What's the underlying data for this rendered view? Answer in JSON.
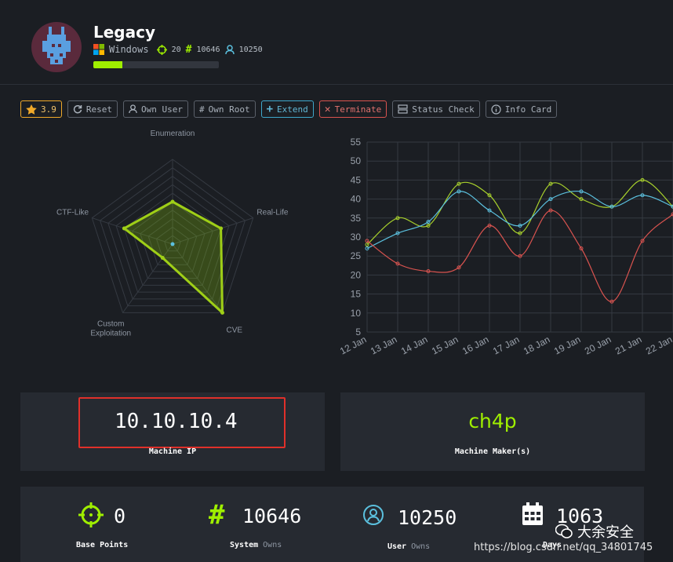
{
  "machine": {
    "name": "Legacy",
    "os": "Windows",
    "points": "20",
    "system_owns": "10646",
    "user_owns": "10250",
    "progress": 0.23
  },
  "toolbar": {
    "rating": "3.9",
    "reset": "Reset",
    "own_user": "Own User",
    "own_root": "Own Root",
    "extend": "Extend",
    "terminate": "Terminate",
    "status_check": "Status Check",
    "info_card": "Info Card"
  },
  "colors": {
    "accent": "#9fef00",
    "blue": "#5bc0de",
    "red": "#d9534f",
    "card": "#262a31"
  },
  "chart_data": [
    {
      "type": "radar",
      "axes": [
        "Enumeration",
        "Real-Life",
        "CVE",
        "Custom Exploitation",
        "CTF-Like"
      ],
      "values": [
        5,
        6,
        10,
        2,
        6
      ],
      "max": 10
    },
    {
      "type": "line",
      "x": [
        "12 Jan",
        "13 Jan",
        "14 Jan",
        "15 Jan",
        "16 Jan",
        "17 Jan",
        "18 Jan",
        "19 Jan",
        "20 Jan",
        "21 Jan",
        "22 Jan"
      ],
      "series": [
        {
          "color": "#a8d02c",
          "values": [
            28,
            35,
            33,
            44,
            41,
            31,
            44,
            40,
            38,
            45,
            38
          ]
        },
        {
          "color": "#5bc0de",
          "values": [
            27,
            31,
            34,
            42,
            37,
            33,
            40,
            42,
            38,
            41,
            38
          ]
        },
        {
          "color": "#d9534f",
          "values": [
            29,
            23,
            21,
            22,
            33,
            25,
            37,
            27,
            13,
            29,
            36
          ]
        }
      ],
      "ylim": [
        5,
        55
      ],
      "yticks": [
        5,
        10,
        15,
        20,
        25,
        30,
        35,
        40,
        45,
        50,
        55
      ],
      "grid": true
    }
  ],
  "ip": {
    "value": "10.10.10.4",
    "label": "Machine IP"
  },
  "maker": {
    "value": "ch4p",
    "label": "Machine Maker(s)"
  },
  "stats": [
    {
      "icon": "crosshair-icon",
      "value": "0",
      "label": "Base Points",
      "sub": ""
    },
    {
      "icon": "hash-icon",
      "value": "10646",
      "label": "System",
      "sub": "Owns"
    },
    {
      "icon": "user-icon",
      "value": "10250",
      "label": "User",
      "sub": "Owns"
    },
    {
      "icon": "calendar-icon",
      "value": "1063",
      "label": "Days",
      "sub": ""
    }
  ],
  "watermark": {
    "text": "大余安全",
    "url": "https://blog.csdn.net/qq_34801745"
  }
}
